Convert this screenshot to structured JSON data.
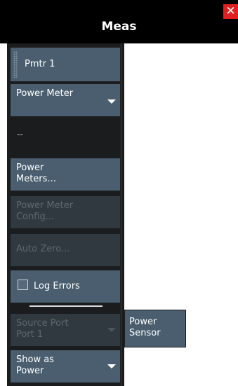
{
  "header": {
    "title": "Meas",
    "close_icon": "close-icon"
  },
  "menu": {
    "pmtr": "Pmtr 1",
    "power_meter_select": "Power Meter",
    "readout": "--",
    "power_meters_line1": "Power",
    "power_meters_line2": "Meters...",
    "config_line1": "Power Meter",
    "config_line2": "Config...",
    "auto_zero": "Auto Zero...",
    "log_errors": "Log Errors",
    "source_port_line1": "Source Port",
    "source_port_line2": "Port 1",
    "show_as_line1": "Show as",
    "show_as_line2": "Power"
  },
  "side": {
    "power_sensor_line1": "Power",
    "power_sensor_line2": "Sensor"
  },
  "colors": {
    "button": "#4a5e6f",
    "disabled": "#2f393f",
    "close": "#e02020",
    "panel": "#1b1c1d"
  }
}
